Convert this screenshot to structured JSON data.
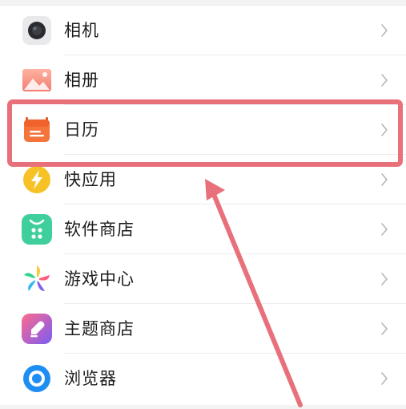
{
  "settings_list": {
    "items": [
      {
        "label": "相机",
        "icon": "camera-icon"
      },
      {
        "label": "相册",
        "icon": "gallery-icon"
      },
      {
        "label": "日历",
        "icon": "calendar-icon"
      },
      {
        "label": "快应用",
        "icon": "quick-app-icon"
      },
      {
        "label": "软件商店",
        "icon": "app-store-icon"
      },
      {
        "label": "游戏中心",
        "icon": "game-center-icon"
      },
      {
        "label": "主题商店",
        "icon": "theme-store-icon"
      },
      {
        "label": "浏览器",
        "icon": "browser-icon"
      }
    ]
  },
  "annotation": {
    "highlight_color": "#e8707a",
    "highlighted_item": "日历"
  }
}
